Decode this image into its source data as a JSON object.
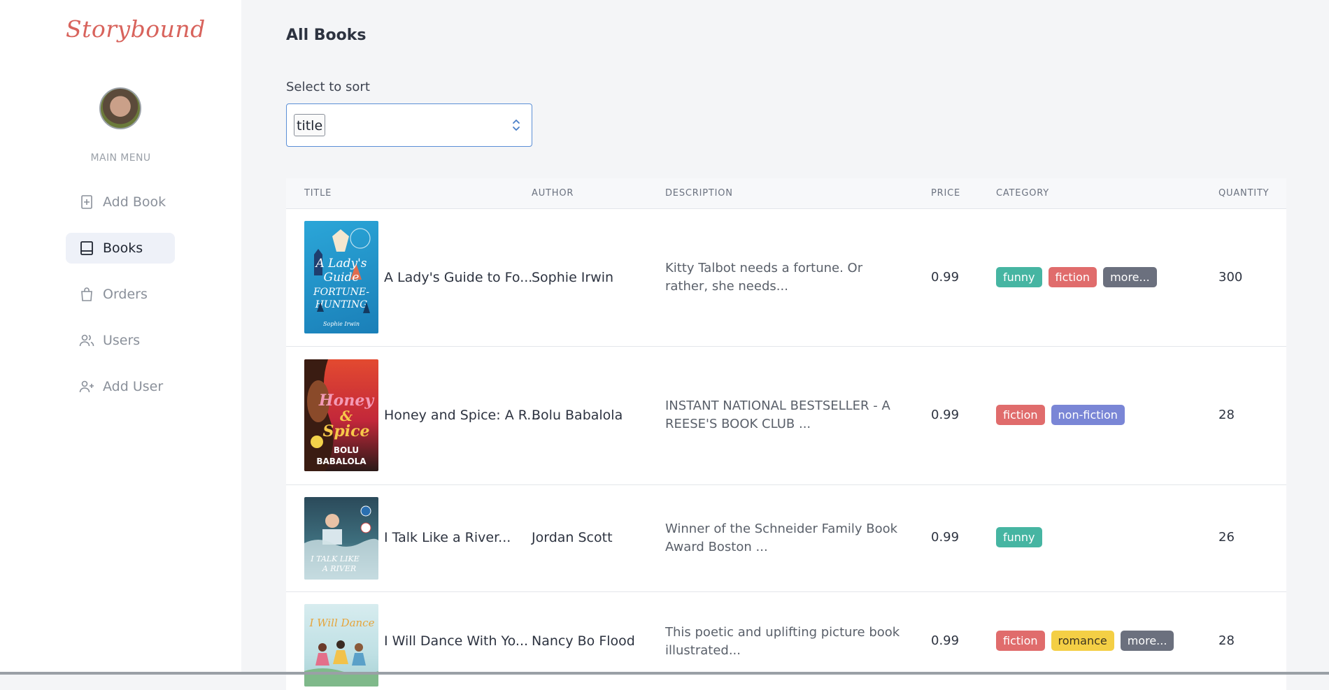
{
  "app": {
    "logo": "Storybound"
  },
  "sidebar": {
    "menu_heading": "MAIN MENU",
    "items": [
      {
        "label": "Add Book",
        "icon": "add-book-icon",
        "active": false
      },
      {
        "label": "Books",
        "icon": "book-icon",
        "active": true
      },
      {
        "label": "Orders",
        "icon": "shopping-bag-icon",
        "active": false
      },
      {
        "label": "Users",
        "icon": "users-icon",
        "active": false
      },
      {
        "label": "Add User",
        "icon": "add-user-icon",
        "active": false
      }
    ]
  },
  "main": {
    "title": "All Books",
    "sort": {
      "label": "Select to sort",
      "value": "title"
    }
  },
  "table": {
    "columns": [
      "TITLE",
      "AUTHOR",
      "DESCRIPTION",
      "PRICE",
      "CATEGORY",
      "QUANTITY"
    ],
    "rows": [
      {
        "title": "A Lady's Guide to Fo...",
        "author": "Sophie Irwin",
        "description": "Kitty Talbot needs a fortune. Or rather, she needs...",
        "price": "0.99",
        "categories": [
          "funny",
          "fiction",
          "more..."
        ],
        "quantity": "300"
      },
      {
        "title": "Honey and Spice: A R...",
        "author": "Bolu Babalola",
        "description": "INSTANT NATIONAL BESTSELLER - A REESE'S BOOK CLUB ...",
        "price": "0.99",
        "categories": [
          "fiction",
          "non-fiction"
        ],
        "quantity": "28"
      },
      {
        "title": "I Talk Like a River...",
        "author": "Jordan Scott",
        "description": "Winner of the Schneider Family Book Award Boston ...",
        "price": "0.99",
        "categories": [
          "funny"
        ],
        "quantity": "26"
      },
      {
        "title": "I Will Dance With Yo...",
        "author": "Nancy Bo Flood",
        "description": "This poetic and uplifting picture book illustrated...",
        "price": "0.99",
        "categories": [
          "fiction",
          "romance",
          "more..."
        ],
        "quantity": "28"
      }
    ]
  },
  "colors": {
    "brand": "#d8635c",
    "funny": "#46b5a2",
    "fiction": "#e06c6c",
    "more": "#6b707e",
    "non_fiction": "#7a86d6",
    "romance": "#f4cf45"
  }
}
